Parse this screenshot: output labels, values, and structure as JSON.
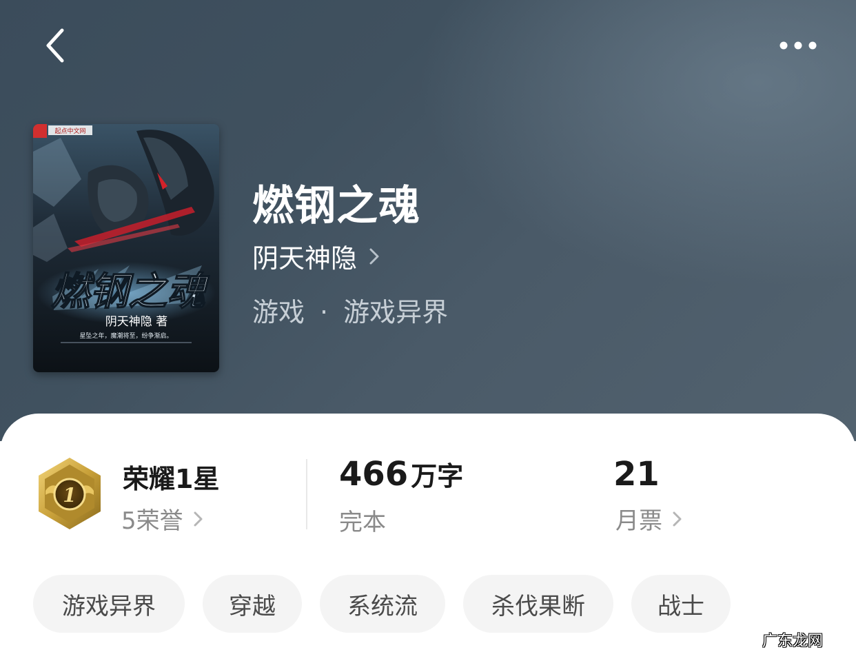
{
  "header": {
    "back_icon": "chevron-left-icon",
    "more_icon": "more-dots-icon"
  },
  "book": {
    "title": "燃钢之魂",
    "author": "阴天神隐",
    "category": "游戏",
    "subcategory": "游戏异界",
    "separator": "·",
    "cover": {
      "title_art": "燃钢之魂",
      "author_line": "阴天神隐 著",
      "tagline": "星坠之年，魔潮将至，纷争渐启。",
      "site_mark": "起点中文网"
    }
  },
  "stats": {
    "honor": {
      "title": "荣耀1星",
      "count_label": "5荣誉",
      "badge_number": "1",
      "badge_icon": "honor-badge-icon"
    },
    "words": {
      "number": "466",
      "unit": "万字",
      "status": "完本"
    },
    "monthly_ticket": {
      "value": "21",
      "label": "月票"
    }
  },
  "tags": [
    "游戏异界",
    "穿越",
    "系统流",
    "杀伐果断",
    "战士"
  ],
  "watermark": "广东龙网",
  "colors": {
    "hero_bg": "#40515f",
    "badge_gold": "#c9a13a",
    "text_dark": "#1a1a1a",
    "text_grey": "#8a8a8a",
    "tag_bg": "#f4f4f4"
  }
}
